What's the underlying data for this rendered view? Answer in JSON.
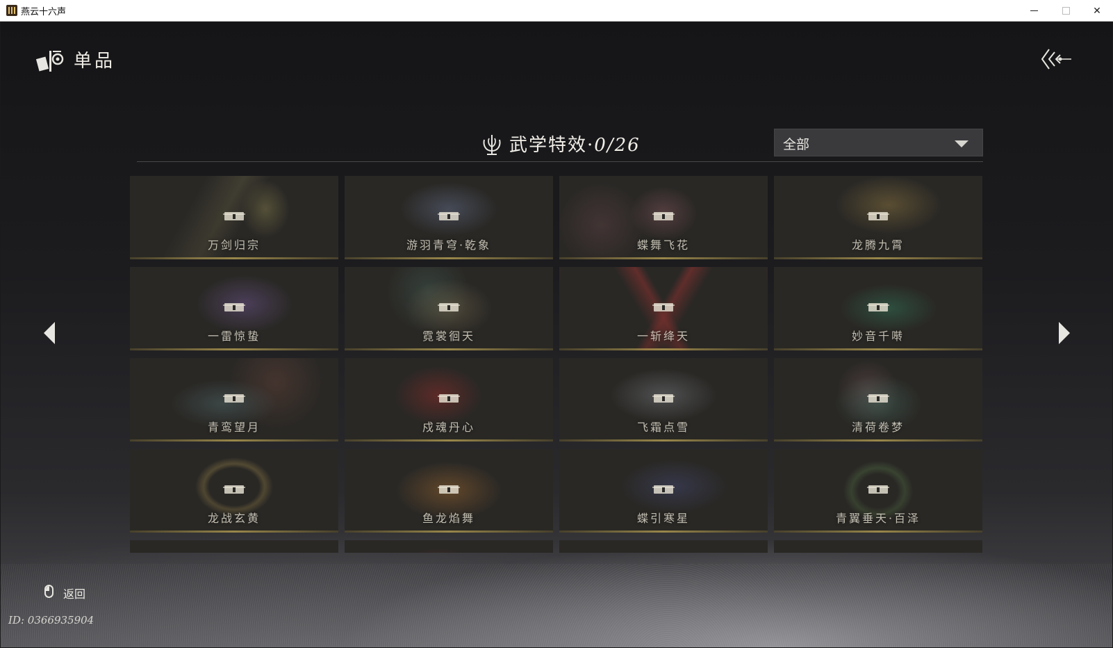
{
  "window": {
    "title": "燕云十六声"
  },
  "header": {
    "section_title": "单品"
  },
  "collection": {
    "title": "武学特效",
    "separator": "·",
    "count": "0/26",
    "filter_value": "全部"
  },
  "items": [
    {
      "name": "万剑归宗",
      "art": "sword"
    },
    {
      "name": "游羽青穹·乾象",
      "art": "crane"
    },
    {
      "name": "蝶舞飞花",
      "art": "butterfly"
    },
    {
      "name": "龙腾九霄",
      "art": "dragon"
    },
    {
      "name": "一雷惊蛰",
      "art": "lightning"
    },
    {
      "name": "霓裳徊天",
      "art": "moon"
    },
    {
      "name": "一斩绛天",
      "art": "slash"
    },
    {
      "name": "妙音千啭",
      "art": "bird"
    },
    {
      "name": "青鸾望月",
      "art": "lake"
    },
    {
      "name": "戍魂丹心",
      "art": "redbolt"
    },
    {
      "name": "飞霜点雪",
      "art": "palace"
    },
    {
      "name": "清荷卷梦",
      "art": "lotus"
    },
    {
      "name": "龙战玄黄",
      "art": "ring"
    },
    {
      "name": "鱼龙焰舞",
      "art": "fish"
    },
    {
      "name": "蝶引寒星",
      "art": "galaxy"
    },
    {
      "name": "青翼垂天·百泽",
      "art": "emerald"
    },
    {
      "name": "",
      "art": "red"
    },
    {
      "name": "",
      "art": "redbolt"
    },
    {
      "name": "",
      "art": "smoke"
    },
    {
      "name": "",
      "art": "smoke"
    }
  ],
  "footer": {
    "back_label": "返回",
    "player_id": "ID: 0366935904"
  },
  "colors": {
    "text": "#e8e6e0",
    "gold_accent": "#c8af5a",
    "card_bg": "#2b2a28",
    "filter_bg": "#46464a"
  },
  "icons": {
    "section": "collection-scroll-icon",
    "back": "triple-chevron-back-icon",
    "collection": "lotus-emblem-icon",
    "lock": "lock-icon",
    "prev": "caret-left-icon",
    "next": "caret-right-icon",
    "mouse": "mouse-right-click-icon"
  }
}
